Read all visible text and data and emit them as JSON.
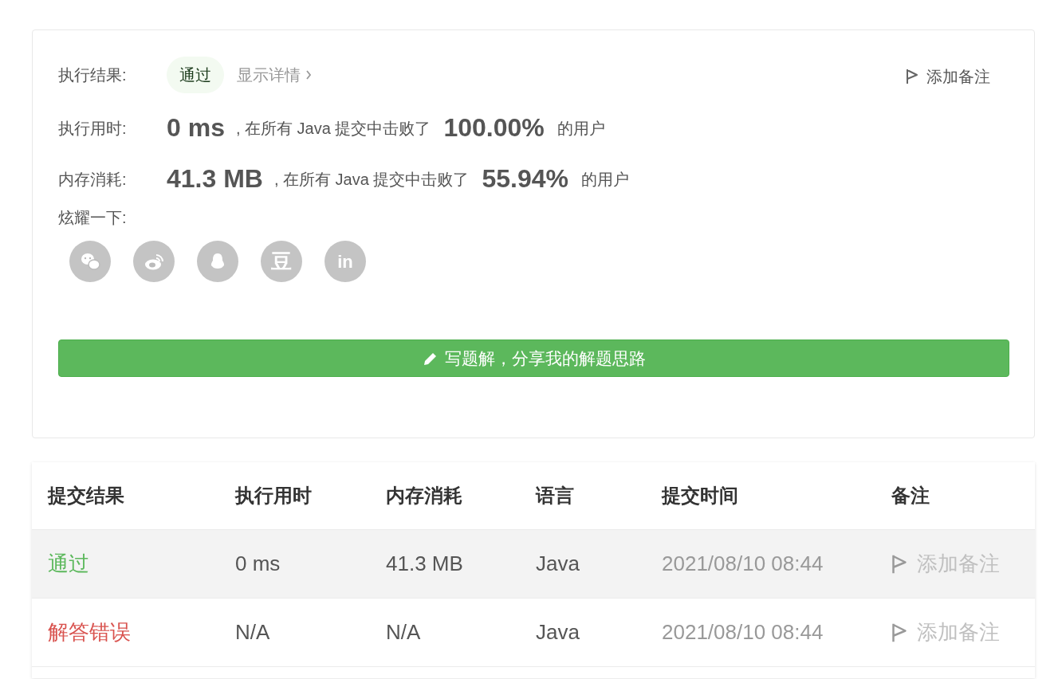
{
  "result_card": {
    "result": {
      "label": "执行结果:",
      "badge": "通过",
      "details_link": "显示详情",
      "add_note": "添加备注"
    },
    "stats": [
      {
        "label": "执行用时:",
        "value": "0 ms",
        "middle": ", 在所有 Java 提交中击败了",
        "percent": "100.00%",
        "suffix": "的用户"
      },
      {
        "label": "内存消耗:",
        "value": "41.3 MB",
        "middle": ", 在所有 Java 提交中击败了",
        "percent": "55.94%",
        "suffix": "的用户"
      }
    ],
    "share": {
      "label": "炫耀一下:",
      "items": [
        {
          "kind": "wechat"
        },
        {
          "kind": "weibo"
        },
        {
          "kind": "qq"
        },
        {
          "kind": "douban",
          "glyph": "豆"
        },
        {
          "kind": "linkedin",
          "glyph": "in"
        }
      ]
    },
    "write_solution_button": "写题解，分享我的解题思路"
  },
  "submissions": {
    "columns": [
      "提交结果",
      "执行用时",
      "内存消耗",
      "语言",
      "提交时间",
      "备注"
    ],
    "rows": [
      {
        "status": "通过",
        "kind": "accepted",
        "time": "0 ms",
        "memory": "41.3 MB",
        "language": "Java",
        "submitted": "2021/08/10 08:44",
        "note": "添加备注",
        "selected": true
      },
      {
        "status": "解答错误",
        "kind": "wrong",
        "time": "N/A",
        "memory": "N/A",
        "language": "Java",
        "submitted": "2021/08/10 08:44",
        "note": "添加备注",
        "selected": false
      }
    ]
  }
}
